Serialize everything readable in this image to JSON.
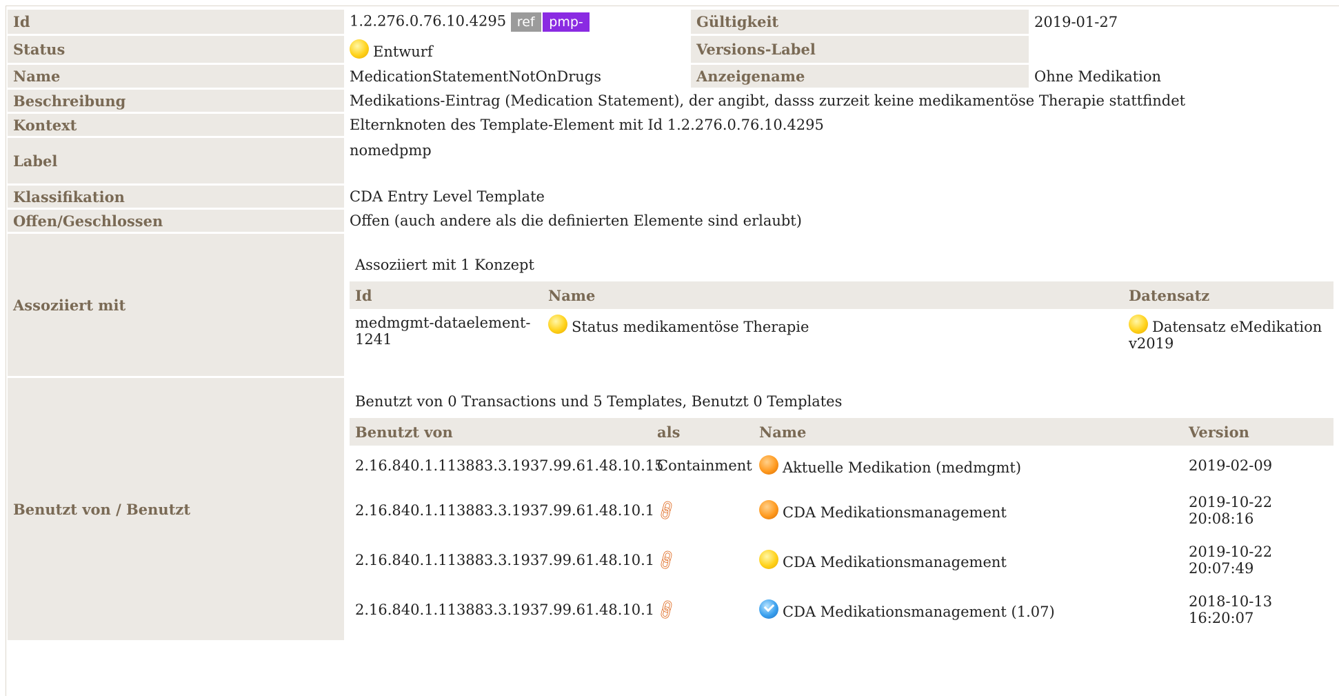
{
  "rows": {
    "id": {
      "label": "Id",
      "value": "1.2.276.0.76.10.4295",
      "ref_badge": "ref",
      "prefix_badge": "pmp-"
    },
    "validity": {
      "label": "Gültigkeit",
      "value": "2019-01-27"
    },
    "status": {
      "label": "Status",
      "value": "Entwurf",
      "icon": "yellow-status-dot"
    },
    "version_label": {
      "label": "Versions-Label",
      "value": ""
    },
    "name": {
      "label": "Name",
      "value": "MedicationStatementNotOnDrugs"
    },
    "display_name": {
      "label": "Anzeigename",
      "value": "Ohne Medikation"
    },
    "description": {
      "label": "Beschreibung",
      "value": "Medikations-Eintrag (Medication Statement), der angibt, dasss zurzeit keine medikamentöse Therapie stattfindet"
    },
    "context": {
      "label": "Kontext",
      "value": "Elternknoten des Template-Element mit Id 1.2.276.0.76.10.4295"
    },
    "label": {
      "label": "Label",
      "value": "nomedpmp"
    },
    "classification": {
      "label": "Klassifikation",
      "value": "CDA Entry Level Template"
    },
    "open_closed": {
      "label": "Offen/Geschlossen",
      "value": "Offen (auch andere als die definierten Elemente sind erlaubt)"
    }
  },
  "associated": {
    "label": "Assoziiert mit",
    "title": "Assoziiert mit 1 Konzept",
    "headers": {
      "id": "Id",
      "name": "Name",
      "dataset": "Datensatz"
    },
    "rows": [
      {
        "id": "medmgmt-dataelement-1241",
        "name": "Status medikamentöse Therapie",
        "dataset": "Datensatz eMedikation v2019",
        "name_icon": "yellow",
        "dataset_icon": "yellow"
      }
    ]
  },
  "used_by": {
    "label": "Benutzt von / Benutzt",
    "title": "Benutzt von 0 Transactions und 5 Templates, Benutzt 0 Templates",
    "headers": {
      "used_by": "Benutzt von",
      "as": "als",
      "name": "Name",
      "version": "Version"
    },
    "rows": [
      {
        "used_by": "2.16.840.1.113883.3.1937.99.61.48.10.15",
        "as": "Containment",
        "name": "Aktuelle Medikation (medmgmt)",
        "icon": "orange",
        "version": "2019-02-09",
        "version_time": ""
      },
      {
        "used_by": "2.16.840.1.113883.3.1937.99.61.48.10.1",
        "as": "",
        "name": "CDA Medikationsmanagement",
        "icon": "orange",
        "version": "2019-10-22",
        "version_time": "20:08:16"
      },
      {
        "used_by": "2.16.840.1.113883.3.1937.99.61.48.10.1",
        "as": "",
        "name": "CDA Medikationsmanagement",
        "icon": "yellow",
        "version": "2019-10-22",
        "version_time": "20:07:49"
      },
      {
        "used_by": "2.16.840.1.113883.3.1937.99.61.48.10.1",
        "as": "",
        "name": "CDA Medikationsmanagement (1.07)",
        "icon": "blue",
        "version": "2018-10-13",
        "version_time": "16:20:07"
      }
    ]
  }
}
